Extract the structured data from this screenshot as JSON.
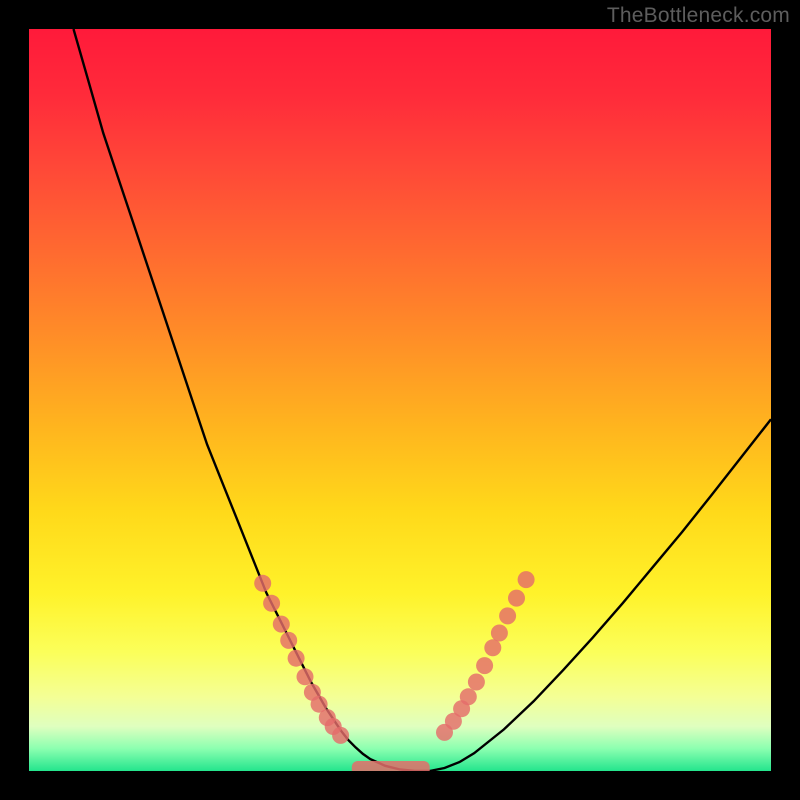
{
  "watermark": {
    "text": "TheBottleneck.com"
  },
  "chart_data": {
    "type": "line",
    "title": "",
    "xlabel": "",
    "ylabel": "",
    "xlim": [
      0,
      100
    ],
    "ylim": [
      0,
      100
    ],
    "grid": false,
    "legend": false,
    "series": [
      {
        "name": "bottleneck-curve",
        "x": [
          6,
          8,
          10,
          12,
          14,
          16,
          18,
          20,
          22,
          24,
          26,
          28,
          30,
          32,
          34,
          36,
          38,
          40,
          42,
          43,
          44,
          45,
          46,
          48,
          50,
          52,
          54,
          56,
          58,
          60,
          64,
          68,
          72,
          76,
          80,
          84,
          88,
          92,
          96,
          100
        ],
        "y": [
          100,
          93,
          86,
          80,
          74,
          68,
          62,
          56,
          50,
          44,
          39,
          34,
          29,
          24,
          20,
          16,
          12,
          8.5,
          5.5,
          4.2,
          3.2,
          2.3,
          1.6,
          0.7,
          0.2,
          0,
          0,
          0.4,
          1.2,
          2.4,
          5.6,
          9.4,
          13.6,
          18.0,
          22.6,
          27.4,
          32.2,
          37.2,
          42.3,
          47.4
        ]
      }
    ],
    "markers": [
      {
        "name": "curve-dots-left",
        "x": [
          31.5,
          32.7,
          34.0,
          35.0,
          36.0,
          37.2,
          38.2,
          39.1,
          40.2,
          41.0,
          42.0
        ],
        "y": [
          25.3,
          22.6,
          19.8,
          17.6,
          15.2,
          12.7,
          10.6,
          9.0,
          7.2,
          6.0,
          4.8
        ]
      },
      {
        "name": "curve-dots-right",
        "x": [
          56.0,
          57.2,
          58.3,
          59.2,
          60.3,
          61.4,
          62.5,
          63.4,
          64.5,
          65.7,
          67.0
        ],
        "y": [
          5.2,
          6.7,
          8.4,
          10.0,
          12.0,
          14.2,
          16.6,
          18.6,
          20.9,
          23.3,
          25.8
        ]
      }
    ],
    "baseline_segment": {
      "name": "baseline-pill",
      "x_start": 43.5,
      "x_end": 54.0,
      "y": 0
    },
    "gradient_stops": [
      {
        "pos": 0.0,
        "color": "#ff1a3a"
      },
      {
        "pos": 0.18,
        "color": "#ff4638"
      },
      {
        "pos": 0.42,
        "color": "#ff8f27"
      },
      {
        "pos": 0.65,
        "color": "#ffd91a"
      },
      {
        "pos": 0.84,
        "color": "#fbff5a"
      },
      {
        "pos": 0.94,
        "color": "#dfffbf"
      },
      {
        "pos": 1.0,
        "color": "#24e58d"
      }
    ]
  }
}
